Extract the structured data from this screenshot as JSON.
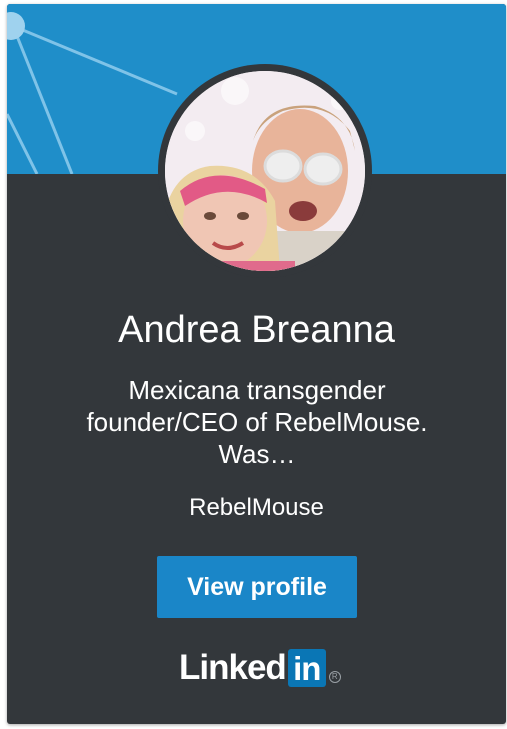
{
  "profile": {
    "name": "Andrea Breanna",
    "headline": "Mexicana transgender founder/CEO of RebelMouse. Was…",
    "company": "RebelMouse"
  },
  "actions": {
    "view_profile_label": "View profile"
  },
  "brand": {
    "logo_word": "Linked",
    "logo_box": "in",
    "logo_reg": "R"
  },
  "colors": {
    "banner": "#1f8ec9",
    "card_background": "#33373b",
    "button": "#1a86c8",
    "logo_box": "#0a76b5"
  },
  "icons": {
    "avatar": "profile-photo",
    "logo": "linkedin-logo"
  }
}
